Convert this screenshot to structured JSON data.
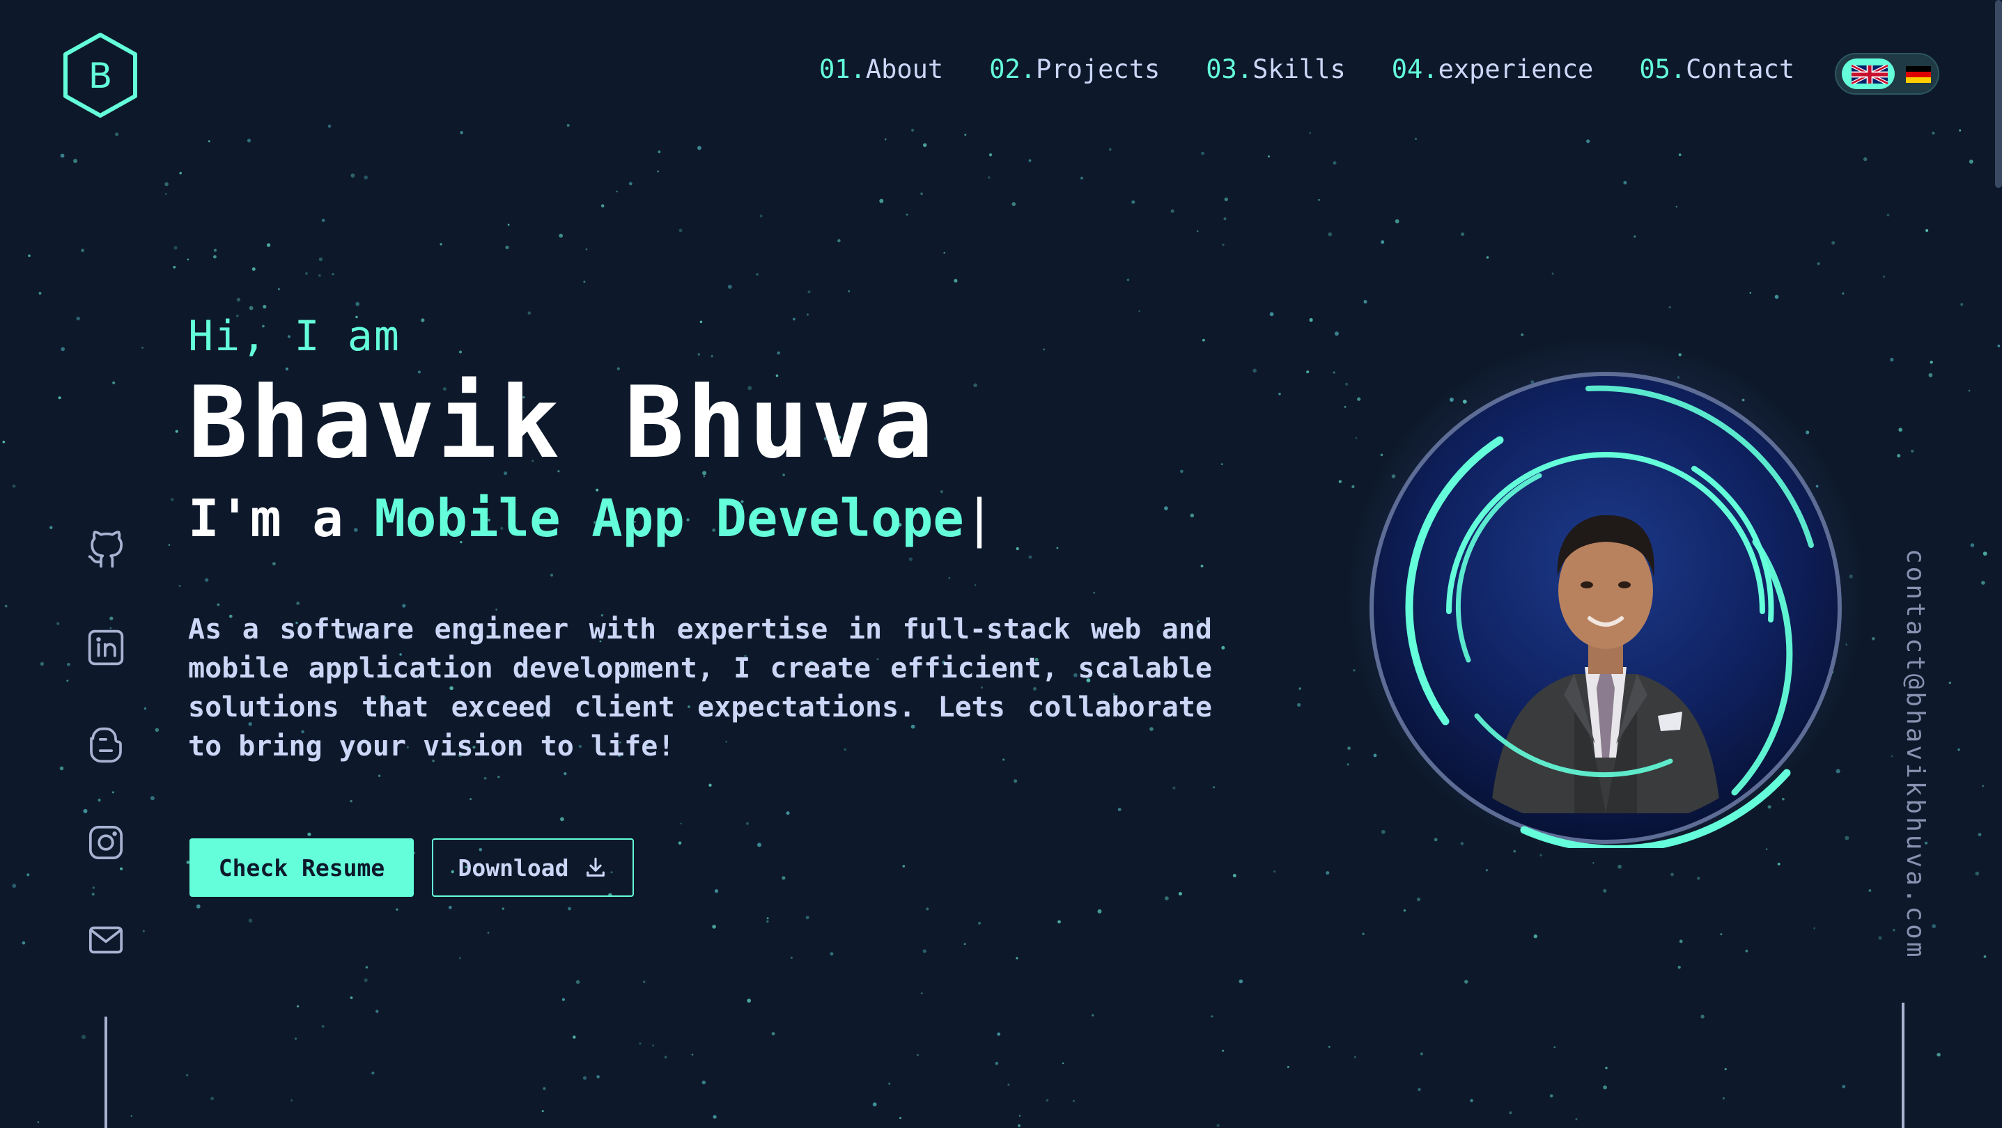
{
  "brand": {
    "logo_letter": "B",
    "logo_icon": "hexagon-logo-icon"
  },
  "nav": [
    {
      "num": "01.",
      "label": "About"
    },
    {
      "num": "02.",
      "label": "Projects"
    },
    {
      "num": "03.",
      "label": "Skills"
    },
    {
      "num": "04.",
      "label": "experience"
    },
    {
      "num": "05.",
      "label": "Contact"
    }
  ],
  "language": {
    "options": [
      "en",
      "de"
    ],
    "active": "en",
    "icons": [
      "uk-flag-icon",
      "germany-flag-icon"
    ]
  },
  "social": [
    {
      "icon": "github-icon"
    },
    {
      "icon": "linkedin-icon"
    },
    {
      "icon": "blogger-icon"
    },
    {
      "icon": "instagram-icon"
    },
    {
      "icon": "mail-icon"
    }
  ],
  "hero": {
    "greeting": "Hi, I am",
    "name": "Bhavik Bhuva",
    "role_prefix": "I'm a ",
    "role_typed": "Mobile App Develope",
    "role_cursor": "|",
    "description": "As a software engineer with expertise in full-stack web and mobile application development, I create efficient, scalable solutions that exceed client expectations. Lets collaborate to bring your vision to life!",
    "resume_button": "Check Resume",
    "download_button": "Download",
    "download_icon": "download-icon"
  },
  "contact_email": "contact@bhavikbhuva.com",
  "colors": {
    "background": "#0d192b",
    "accent": "#64ffda",
    "text": "#ccd6f6",
    "muted": "#8892b0",
    "heading": "#ffffff"
  }
}
